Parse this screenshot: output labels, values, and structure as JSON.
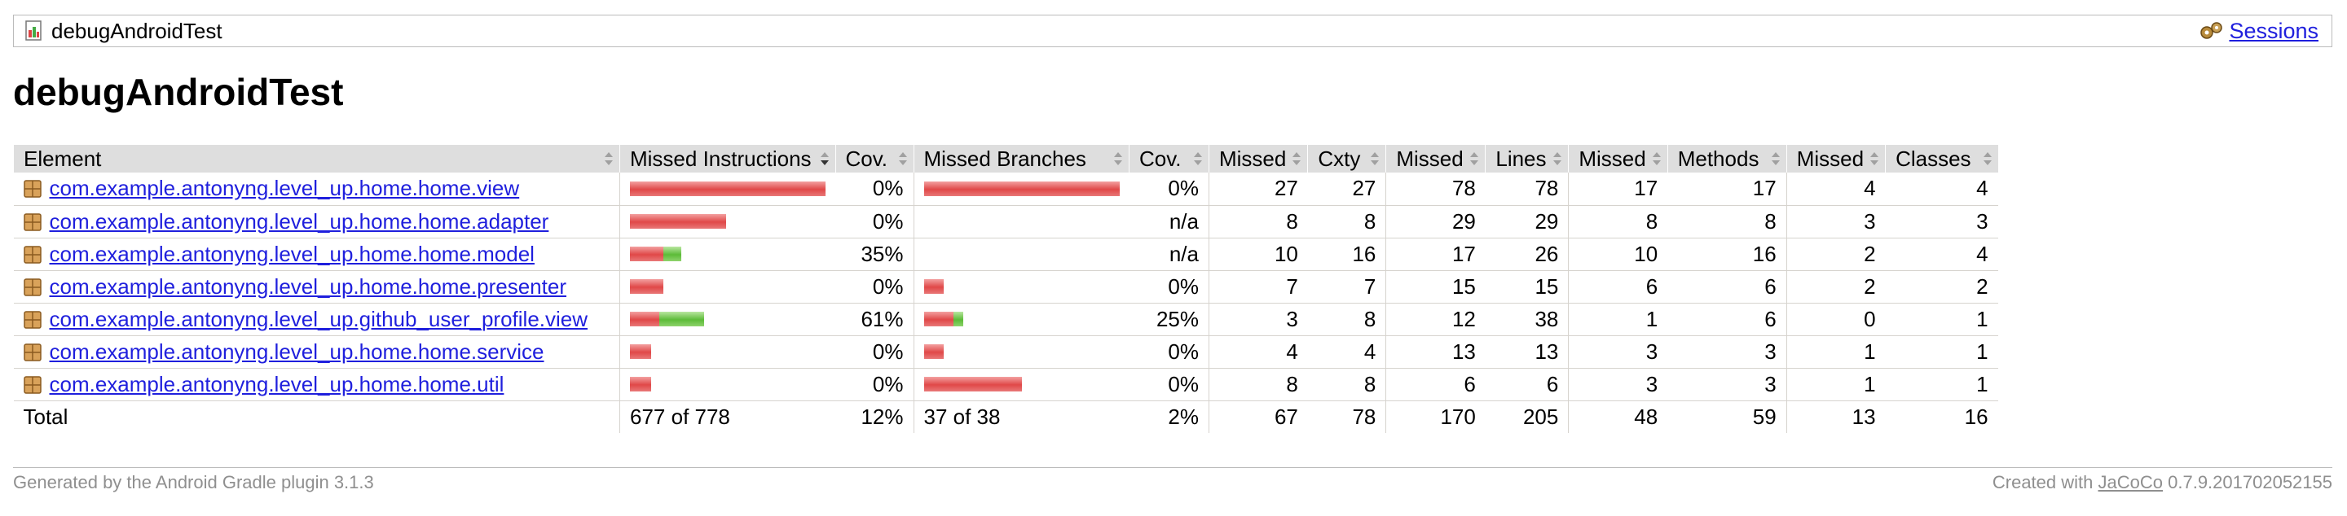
{
  "breadcrumb": {
    "title": "debugAndroidTest",
    "sessions_label": "Sessions"
  },
  "page_title": "debugAndroidTest",
  "table": {
    "headers": [
      "Element",
      "Missed Instructions",
      "Cov.",
      "Missed Branches",
      "Cov.",
      "Missed",
      "Cxty",
      "Missed",
      "Lines",
      "Missed",
      "Methods",
      "Missed",
      "Classes"
    ],
    "rows": [
      {
        "name": "com.example.antonyng.level_up.home.home.view",
        "instr": {
          "missed": 1.0,
          "covered": 0.0
        },
        "instr_cov": "0%",
        "branch": {
          "missed": 1.0,
          "covered": 0.0
        },
        "branch_cov": "0%",
        "cxty_missed": "27",
        "cxty": "27",
        "lines_missed": "78",
        "lines": "78",
        "methods_missed": "17",
        "methods": "17",
        "classes_missed": "4",
        "classes": "4"
      },
      {
        "name": "com.example.antonyng.level_up.home.home.adapter",
        "instr": {
          "missed": 0.49,
          "covered": 0.0
        },
        "instr_cov": "0%",
        "branch": {
          "missed": 0.0,
          "covered": 0.0
        },
        "branch_cov": "n/a",
        "cxty_missed": "8",
        "cxty": "8",
        "lines_missed": "29",
        "lines": "29",
        "methods_missed": "8",
        "methods": "8",
        "classes_missed": "3",
        "classes": "3"
      },
      {
        "name": "com.example.antonyng.level_up.home.home.model",
        "instr": {
          "missed": 0.17,
          "covered": 0.09
        },
        "instr_cov": "35%",
        "branch": {
          "missed": 0.0,
          "covered": 0.0
        },
        "branch_cov": "n/a",
        "cxty_missed": "10",
        "cxty": "16",
        "lines_missed": "17",
        "lines": "26",
        "methods_missed": "10",
        "methods": "16",
        "classes_missed": "2",
        "classes": "4"
      },
      {
        "name": "com.example.antonyng.level_up.home.home.presenter",
        "instr": {
          "missed": 0.17,
          "covered": 0.0
        },
        "instr_cov": "0%",
        "branch": {
          "missed": 0.1,
          "covered": 0.0
        },
        "branch_cov": "0%",
        "cxty_missed": "7",
        "cxty": "7",
        "lines_missed": "15",
        "lines": "15",
        "methods_missed": "6",
        "methods": "6",
        "classes_missed": "2",
        "classes": "2"
      },
      {
        "name": "com.example.antonyng.level_up.github_user_profile.view",
        "instr": {
          "missed": 0.15,
          "covered": 0.23
        },
        "instr_cov": "61%",
        "branch": {
          "missed": 0.15,
          "covered": 0.05
        },
        "branch_cov": "25%",
        "cxty_missed": "3",
        "cxty": "8",
        "lines_missed": "12",
        "lines": "38",
        "methods_missed": "1",
        "methods": "6",
        "classes_missed": "0",
        "classes": "1"
      },
      {
        "name": "com.example.antonyng.level_up.home.home.service",
        "instr": {
          "missed": 0.11,
          "covered": 0.0
        },
        "instr_cov": "0%",
        "branch": {
          "missed": 0.1,
          "covered": 0.0
        },
        "branch_cov": "0%",
        "cxty_missed": "4",
        "cxty": "4",
        "lines_missed": "13",
        "lines": "13",
        "methods_missed": "3",
        "methods": "3",
        "classes_missed": "1",
        "classes": "1"
      },
      {
        "name": "com.example.antonyng.level_up.home.home.util",
        "instr": {
          "missed": 0.11,
          "covered": 0.0
        },
        "instr_cov": "0%",
        "branch": {
          "missed": 0.5,
          "covered": 0.0
        },
        "branch_cov": "0%",
        "cxty_missed": "8",
        "cxty": "8",
        "lines_missed": "6",
        "lines": "6",
        "methods_missed": "3",
        "methods": "3",
        "classes_missed": "1",
        "classes": "1"
      }
    ],
    "total": {
      "label": "Total",
      "instr": "677 of 778",
      "instr_cov": "12%",
      "branch": "37 of 38",
      "branch_cov": "2%",
      "cxty_missed": "67",
      "cxty": "78",
      "lines_missed": "170",
      "lines": "205",
      "methods_missed": "48",
      "methods": "59",
      "classes_missed": "13",
      "classes": "16"
    }
  },
  "footer": {
    "generated": "Generated by the Android Gradle plugin 3.1.3",
    "created_prefix": "Created with",
    "created_link": "JaCoCo",
    "created_version": "0.7.9.201702052155"
  },
  "colors": {
    "missed": "#e04848",
    "covered": "#5cbb38",
    "link": "#1f1fdd",
    "header_bg": "#dedede"
  }
}
